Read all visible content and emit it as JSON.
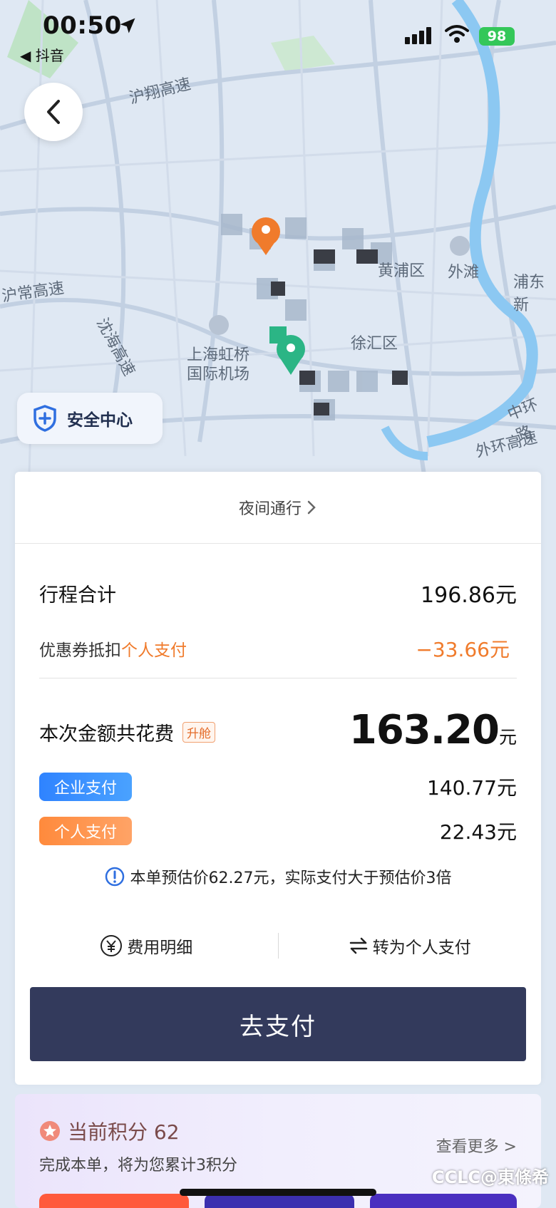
{
  "status_bar": {
    "time": "00:50",
    "back_app": "◀ 抖音",
    "battery": "98"
  },
  "map": {
    "labels": [
      "沪翔高速",
      "沪常高速",
      "沈海高速",
      "上海虹桥",
      "国际机场",
      "徐汇区",
      "外滩",
      "浦东新",
      "中环路",
      "外环高速",
      "黄浦区"
    ],
    "colors": {
      "background": "#dfe8f3",
      "road": "#c2d0e2",
      "river": "#8cc8f2",
      "green": "#bfe3c6"
    }
  },
  "safety_center": {
    "label": "安全中心"
  },
  "trip": {
    "night_link": "夜间通行",
    "total_label": "行程合计",
    "total_value": "196.86元",
    "coupon_label": "优惠券抵扣",
    "coupon_payer": "个人支付",
    "coupon_value": "−33.66元",
    "spend_label": "本次金额共花费",
    "upgrade_tag": "升舱",
    "spend_value": "163.20",
    "spend_unit": "元",
    "enterprise_label": "企业支付",
    "enterprise_value": "140.77元",
    "personal_label": "个人支付",
    "personal_value": "22.43元",
    "notice": "本单预估价62.27元，实际支付大于预估价3倍",
    "fee_detail": "费用明细",
    "switch_personal": "转为个人支付",
    "pay_button": "去支付"
  },
  "points": {
    "title": "当前积分 62",
    "subtitle": "完成本单，将为您累计3积分",
    "more": "查看更多 >"
  },
  "watermark": "CCLC@東條希"
}
